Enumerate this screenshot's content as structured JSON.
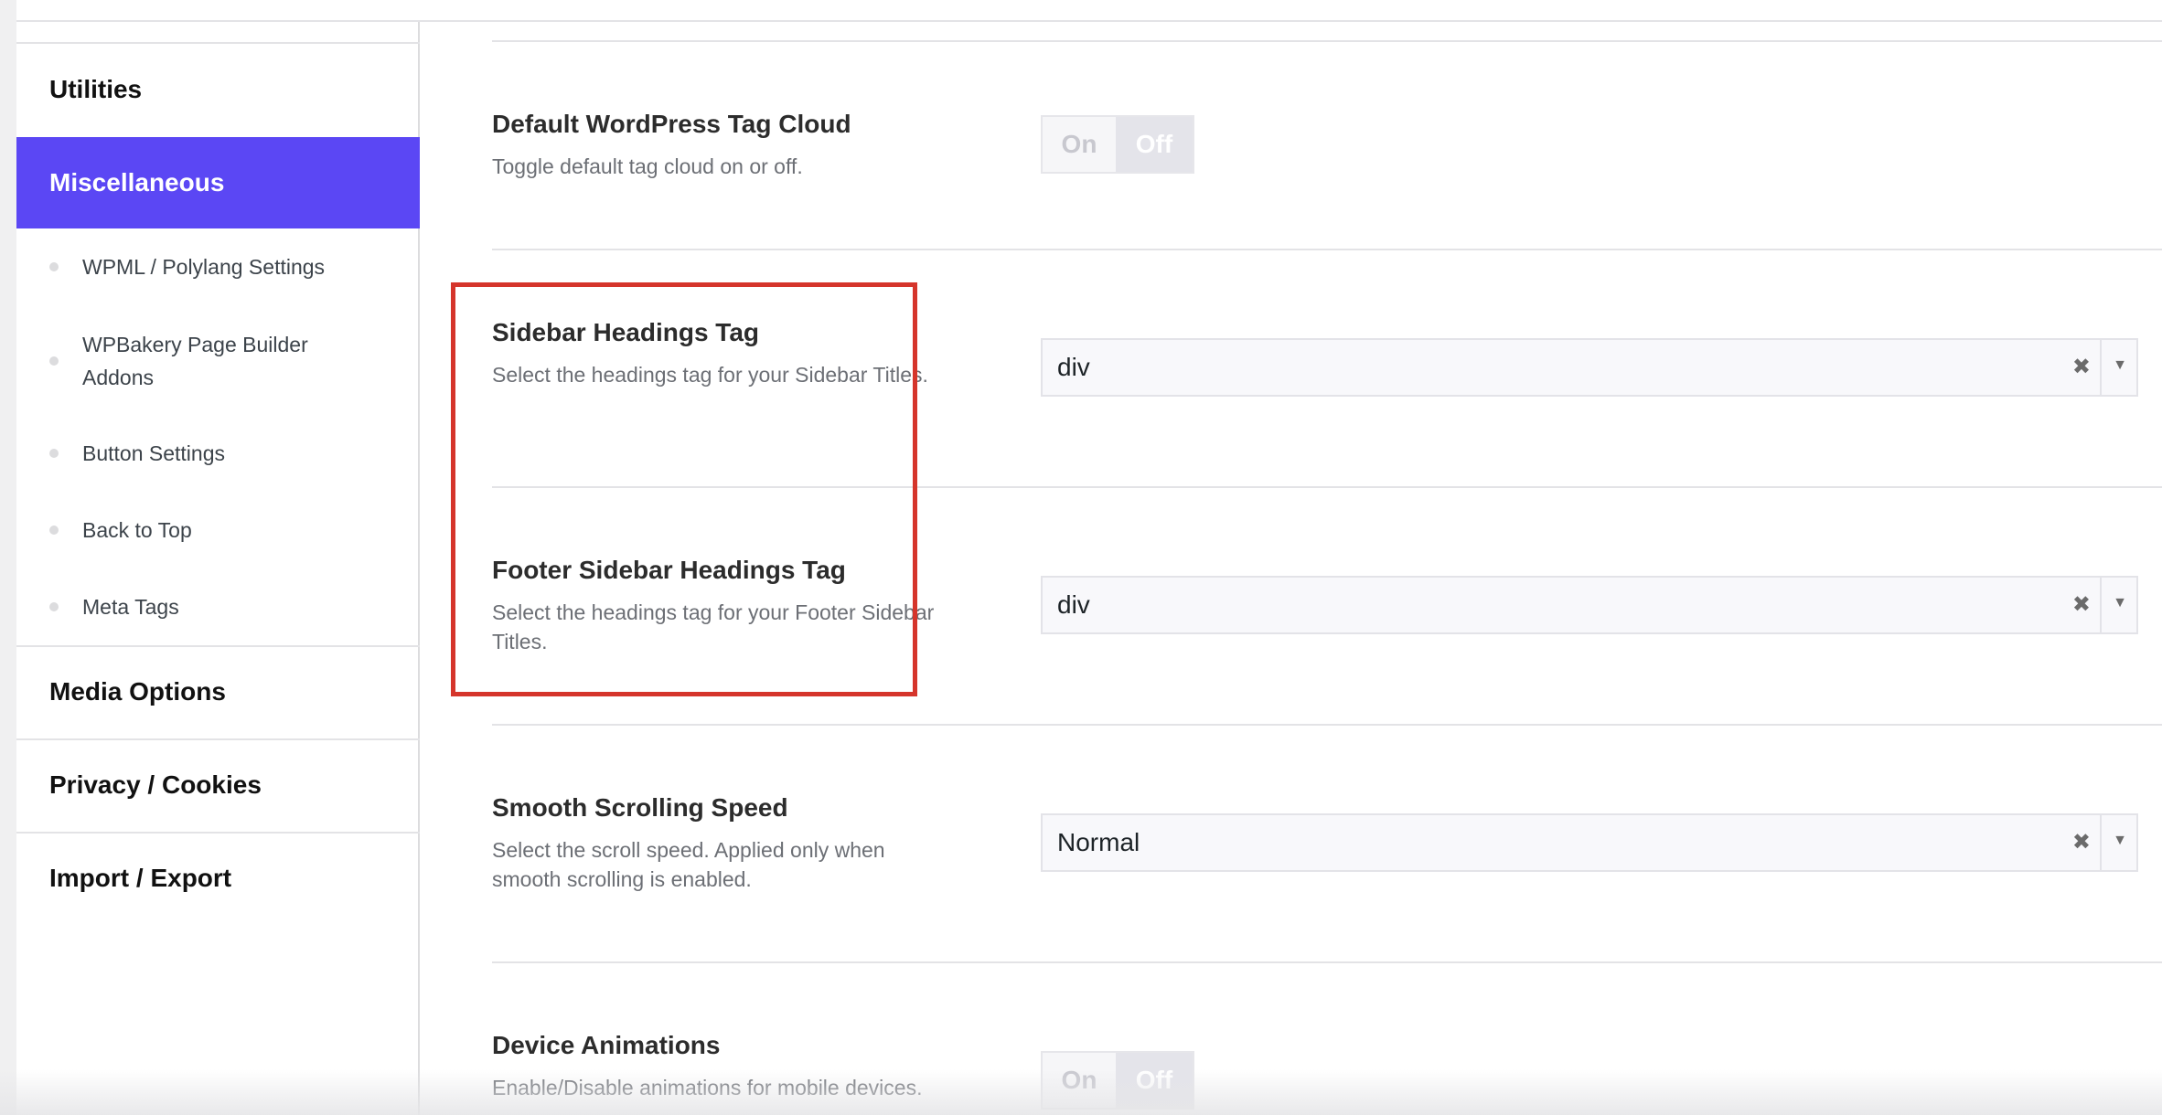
{
  "sidebar": {
    "sections_top": [
      {
        "label": "Utilities"
      },
      {
        "label": "Miscellaneous"
      }
    ],
    "sub_items": [
      {
        "label": "WPML / Polylang Settings"
      },
      {
        "label": "WPBakery Page Builder Addons"
      },
      {
        "label": "Button Settings"
      },
      {
        "label": "Back to Top"
      },
      {
        "label": "Meta Tags"
      }
    ],
    "sections_bottom": [
      {
        "label": "Media Options"
      },
      {
        "label": "Privacy / Cookies"
      },
      {
        "label": "Import / Export"
      }
    ],
    "active_color": "#5b47f4"
  },
  "options": {
    "tag_cloud": {
      "title": "Default WordPress Tag Cloud",
      "desc": "Toggle default tag cloud on or off.",
      "on_label": "On",
      "off_label": "Off"
    },
    "sidebar_headings": {
      "title": "Sidebar Headings Tag",
      "desc": "Select the headings tag for your Sidebar Titles.",
      "value": "div",
      "clear_icon": "✖",
      "arrow_icon": "▼"
    },
    "footer_sidebar_headings": {
      "title": "Footer Sidebar Headings Tag",
      "desc": "Select the headings tag for your Footer Sidebar Titles.",
      "value": "div",
      "clear_icon": "✖",
      "arrow_icon": "▼"
    },
    "smooth_scrolling": {
      "title": "Smooth Scrolling Speed",
      "desc": "Select the scroll speed. Applied only when smooth scrolling is enabled.",
      "value": "Normal",
      "clear_icon": "✖",
      "arrow_icon": "▼"
    },
    "device_animations": {
      "title": "Device Animations",
      "desc": "Enable/Disable animations for mobile devices.",
      "on_label": "On",
      "off_label": "Off"
    }
  },
  "highlight_color": "#d5352b"
}
